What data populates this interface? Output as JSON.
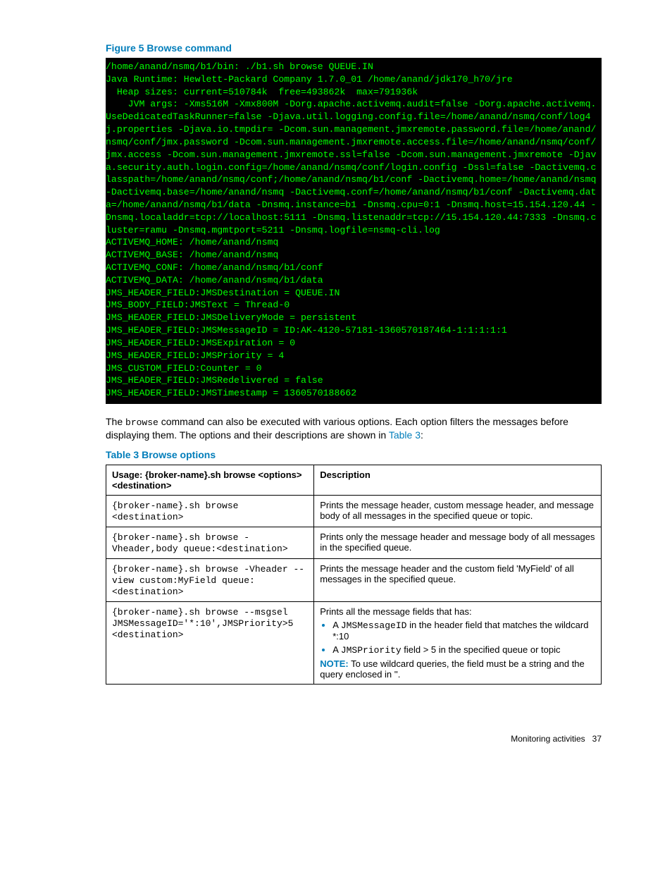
{
  "figure": {
    "caption": "Figure 5 Browse command",
    "terminal_lines": [
      "/home/anand/nsmq/b1/bin: ./b1.sh browse QUEUE.IN",
      "Java Runtime: Hewlett-Packard Company 1.7.0_01 /home/anand/jdk170_h70/jre",
      "  Heap sizes: current=510784k  free=493862k  max=791936k",
      "    JVM args: -Xms516M -Xmx800M -Dorg.apache.activemq.audit=false -Dorg.apache.activemq.UseDedicatedTaskRunner=false -Djava.util.logging.config.file=/home/anand/nsmq/conf/log4j.properties -Djava.io.tmpdir= -Dcom.sun.management.jmxremote.password.file=/home/anand/nsmq/conf/jmx.password -Dcom.sun.management.jmxremote.access.file=/home/anand/nsmq/conf/jmx.access -Dcom.sun.management.jmxremote.ssl=false -Dcom.sun.management.jmxremote -Djava.security.auth.login.config=/home/anand/nsmq/conf/login.config -Dssl=false -Dactivemq.classpath=/home/anand/nsmq/conf;/home/anand/nsmq/b1/conf -Dactivemq.home=/home/anand/nsmq -Dactivemq.base=/home/anand/nsmq -Dactivemq.conf=/home/anand/nsmq/b1/conf -Dactivemq.data=/home/anand/nsmq/b1/data -Dnsmq.instance=b1 -Dnsmq.cpu=0:1 -Dnsmq.host=15.154.120.44 -Dnsmq.localaddr=tcp://localhost:5111 -Dnsmq.listenaddr=tcp://15.154.120.44:7333 -Dnsmq.cluster=ramu -Dnsmq.mgmtport=5211 -Dnsmq.logfile=nsmq-cli.log",
      "ACTIVEMQ_HOME: /home/anand/nsmq",
      "ACTIVEMQ_BASE: /home/anand/nsmq",
      "ACTIVEMQ_CONF: /home/anand/nsmq/b1/conf",
      "ACTIVEMQ_DATA: /home/anand/nsmq/b1/data",
      "JMS_HEADER_FIELD:JMSDestination = QUEUE.IN",
      "JMS_BODY_FIELD:JMSText = Thread-0",
      "JMS_HEADER_FIELD:JMSDeliveryMode = persistent",
      "JMS_HEADER_FIELD:JMSMessageID = ID:AK-4120-57181-1360570187464-1:1:1:1:1",
      "JMS_HEADER_FIELD:JMSExpiration = 0",
      "JMS_HEADER_FIELD:JMSPriority = 4",
      "JMS_CUSTOM_FIELD:Counter = 0",
      "JMS_HEADER_FIELD:JMSRedelivered = false",
      "JMS_HEADER_FIELD:JMSTimestamp = 1360570188662"
    ]
  },
  "paragraph": {
    "prefix": "The ",
    "command": "browse",
    "mid": " command can also be executed with various options. Each option filters the messages before displaying them. The options and their descriptions are shown in ",
    "link": "Table 3",
    "suffix": ":"
  },
  "table": {
    "caption": "Table 3 Browse options",
    "header_usage_line1": "Usage: {broker-name}.sh browse <options>",
    "header_usage_line2": "<destination>",
    "header_desc": "Description",
    "rows": [
      {
        "usage": "{broker-name}.sh browse <destination>",
        "desc_plain": "Prints the message header, custom message header, and message body of all messages in the specified queue or topic."
      },
      {
        "usage": "{broker-name}.sh browse -Vheader,body queue:<destination>",
        "desc_plain": "Prints only the message header and message body of all messages in the specified queue."
      },
      {
        "usage": "{broker-name}.sh browse -Vheader --view custom:MyField queue:<destination>",
        "desc_plain": "Prints the message header and the custom field 'MyField' of all messages in the specified queue."
      },
      {
        "usage": "{broker-name}.sh browse --msgsel JMSMessageID='*:10',JMSPriority>5 <destination>",
        "complex": {
          "intro": "Prints all the message fields that has:",
          "bullet1_pre": "A ",
          "bullet1_code": "JMSMessageID",
          "bullet1_post": " in the header field that matches the wildcard *:10",
          "bullet2_pre": "A ",
          "bullet2_code": "JMSPriority",
          "bullet2_post": " field > 5 in the specified queue or topic",
          "note_label": "NOTE:",
          "note_text": "   To use wildcard queries, the field must be a string and the query enclosed in ''."
        }
      }
    ]
  },
  "footer": {
    "section": "Monitoring activities",
    "page": "37"
  }
}
